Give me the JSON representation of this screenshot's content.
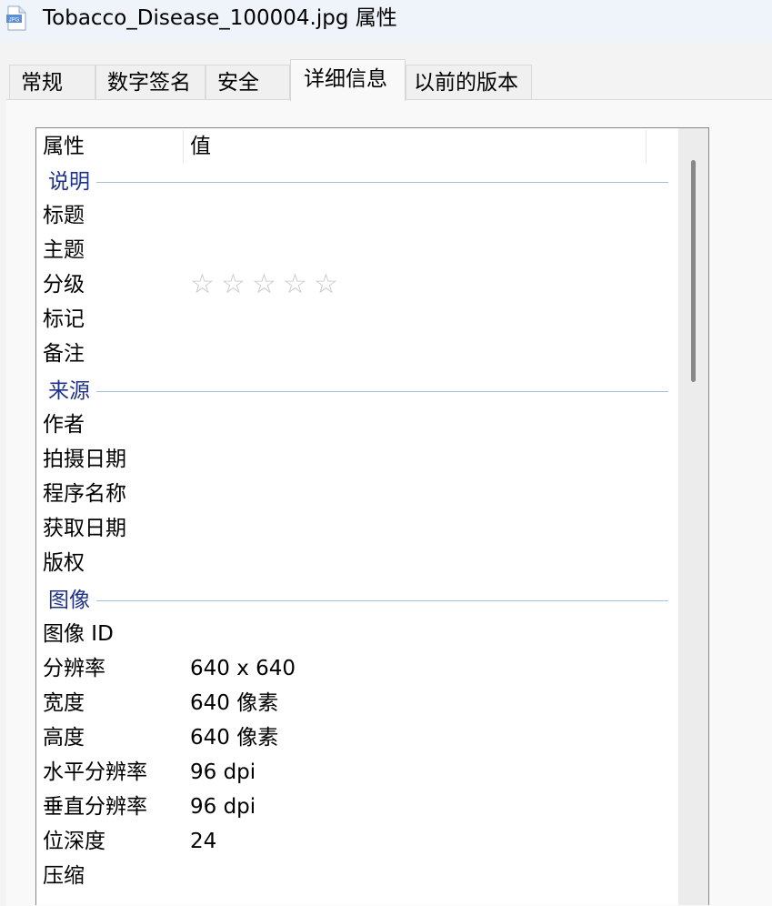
{
  "window": {
    "title": "Tobacco_Disease_100004.jpg 属性",
    "file_icon_text": "JPG"
  },
  "tabs": [
    {
      "label": "常规"
    },
    {
      "label": "数字签名"
    },
    {
      "label": "安全"
    },
    {
      "label": "详细信息",
      "active": true
    },
    {
      "label": "以前的版本"
    }
  ],
  "list": {
    "headers": {
      "property": "属性",
      "value": "值"
    },
    "groups": {
      "description": {
        "label": "说明",
        "rows": [
          {
            "name": "标题",
            "value": ""
          },
          {
            "name": "主题",
            "value": ""
          },
          {
            "name": "分级",
            "rating_stars": 0,
            "rating_max": 5
          },
          {
            "name": "标记",
            "value": ""
          },
          {
            "name": "备注",
            "value": ""
          }
        ]
      },
      "origin": {
        "label": "来源",
        "rows": [
          {
            "name": "作者",
            "value": ""
          },
          {
            "name": "拍摄日期",
            "value": ""
          },
          {
            "name": "程序名称",
            "value": ""
          },
          {
            "name": "获取日期",
            "value": ""
          },
          {
            "name": "版权",
            "value": ""
          }
        ]
      },
      "image": {
        "label": "图像",
        "rows": [
          {
            "name": "图像 ID",
            "value": ""
          },
          {
            "name": "分辨率",
            "value": "640 x 640"
          },
          {
            "name": "宽度",
            "value": "640 像素"
          },
          {
            "name": "高度",
            "value": "640 像素"
          },
          {
            "name": "水平分辨率",
            "value": "96 dpi"
          },
          {
            "name": "垂直分辨率",
            "value": "96 dpi"
          },
          {
            "name": "位深度",
            "value": "24"
          },
          {
            "name": "压缩",
            "value": ""
          }
        ]
      }
    }
  },
  "colors": {
    "group_label": "#1e3287",
    "group_line": "#a8c0d6",
    "star_empty": "#c6c6c6"
  },
  "icons": {
    "file": "jpg-file-icon",
    "rating_empty": "☆"
  }
}
